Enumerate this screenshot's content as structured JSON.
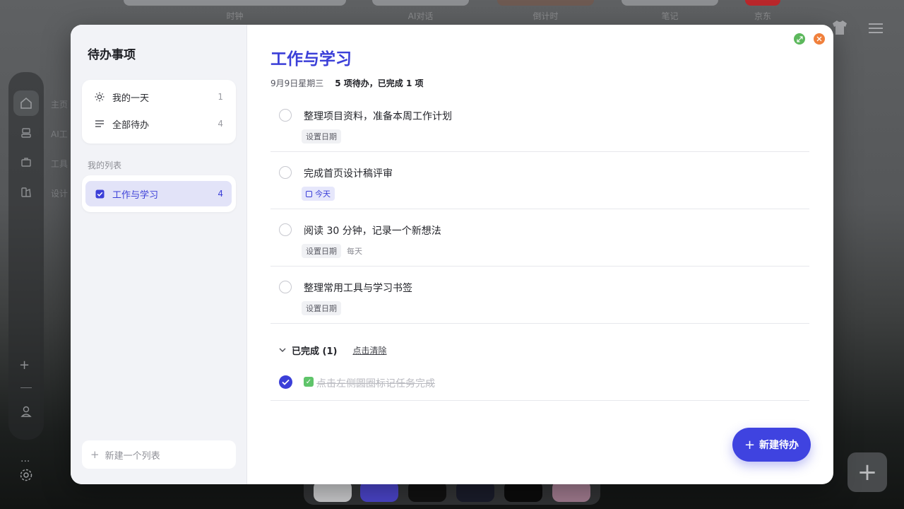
{
  "desktop": {
    "top_apps": [
      {
        "label": "时钟"
      },
      {
        "label": "AI对话"
      },
      {
        "label": "倒计时"
      },
      {
        "label": "笔记"
      },
      {
        "label": "京东"
      }
    ],
    "rail_labels": [
      "主页",
      "AI工",
      "工具",
      "设计"
    ]
  },
  "sidebar": {
    "title": "待办事项",
    "smart_lists": [
      {
        "label": "我的一天",
        "count": "1",
        "icon": "sun-icon"
      },
      {
        "label": "全部待办",
        "count": "4",
        "icon": "list-icon"
      }
    ],
    "section_label": "我的列表",
    "lists": [
      {
        "label": "工作与学习",
        "count": "4",
        "icon": "checkbox-icon",
        "active": true
      }
    ],
    "new_list_label": "新建一个列表"
  },
  "main": {
    "title": "工作与学习",
    "date": "9月9日星期三",
    "summary": "5 项待办，已完成 1 项",
    "tasks": [
      {
        "title": "整理项目资料，准备本周工作计划",
        "due": "设置日期",
        "repeat": ""
      },
      {
        "title": "完成首页设计稿评审",
        "due": "今天",
        "repeat": ""
      },
      {
        "title": "阅读 30 分钟，记录一个新想法",
        "due": "设置日期",
        "repeat": "每天"
      },
      {
        "title": "整理常用工具与学习书签",
        "due": "设置日期",
        "repeat": ""
      }
    ],
    "completed": {
      "header": "已完成 (1)",
      "clear_label": "点击清除",
      "items": [
        {
          "title": "点击左侧圆圈标记任务完成"
        }
      ]
    },
    "new_todo_label": "新建待办"
  },
  "colors": {
    "accent": "#3b3fd8",
    "fab": "#3f43e0",
    "maximize": "#5cb85c",
    "close": "#f0803c"
  }
}
